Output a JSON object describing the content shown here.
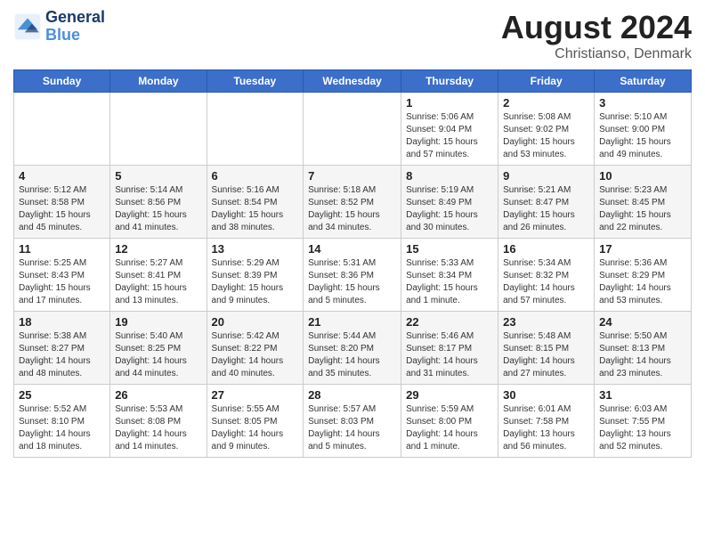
{
  "logo": {
    "line1": "General",
    "line2": "Blue"
  },
  "title": {
    "month_year": "August 2024",
    "location": "Christianso, Denmark"
  },
  "days_of_week": [
    "Sunday",
    "Monday",
    "Tuesday",
    "Wednesday",
    "Thursday",
    "Friday",
    "Saturday"
  ],
  "weeks": [
    [
      {
        "day": "",
        "info": ""
      },
      {
        "day": "",
        "info": ""
      },
      {
        "day": "",
        "info": ""
      },
      {
        "day": "",
        "info": ""
      },
      {
        "day": "1",
        "info": "Sunrise: 5:06 AM\nSunset: 9:04 PM\nDaylight: 15 hours and 57 minutes."
      },
      {
        "day": "2",
        "info": "Sunrise: 5:08 AM\nSunset: 9:02 PM\nDaylight: 15 hours and 53 minutes."
      },
      {
        "day": "3",
        "info": "Sunrise: 5:10 AM\nSunset: 9:00 PM\nDaylight: 15 hours and 49 minutes."
      }
    ],
    [
      {
        "day": "4",
        "info": "Sunrise: 5:12 AM\nSunset: 8:58 PM\nDaylight: 15 hours and 45 minutes."
      },
      {
        "day": "5",
        "info": "Sunrise: 5:14 AM\nSunset: 8:56 PM\nDaylight: 15 hours and 41 minutes."
      },
      {
        "day": "6",
        "info": "Sunrise: 5:16 AM\nSunset: 8:54 PM\nDaylight: 15 hours and 38 minutes."
      },
      {
        "day": "7",
        "info": "Sunrise: 5:18 AM\nSunset: 8:52 PM\nDaylight: 15 hours and 34 minutes."
      },
      {
        "day": "8",
        "info": "Sunrise: 5:19 AM\nSunset: 8:49 PM\nDaylight: 15 hours and 30 minutes."
      },
      {
        "day": "9",
        "info": "Sunrise: 5:21 AM\nSunset: 8:47 PM\nDaylight: 15 hours and 26 minutes."
      },
      {
        "day": "10",
        "info": "Sunrise: 5:23 AM\nSunset: 8:45 PM\nDaylight: 15 hours and 22 minutes."
      }
    ],
    [
      {
        "day": "11",
        "info": "Sunrise: 5:25 AM\nSunset: 8:43 PM\nDaylight: 15 hours and 17 minutes."
      },
      {
        "day": "12",
        "info": "Sunrise: 5:27 AM\nSunset: 8:41 PM\nDaylight: 15 hours and 13 minutes."
      },
      {
        "day": "13",
        "info": "Sunrise: 5:29 AM\nSunset: 8:39 PM\nDaylight: 15 hours and 9 minutes."
      },
      {
        "day": "14",
        "info": "Sunrise: 5:31 AM\nSunset: 8:36 PM\nDaylight: 15 hours and 5 minutes."
      },
      {
        "day": "15",
        "info": "Sunrise: 5:33 AM\nSunset: 8:34 PM\nDaylight: 15 hours and 1 minute."
      },
      {
        "day": "16",
        "info": "Sunrise: 5:34 AM\nSunset: 8:32 PM\nDaylight: 14 hours and 57 minutes."
      },
      {
        "day": "17",
        "info": "Sunrise: 5:36 AM\nSunset: 8:29 PM\nDaylight: 14 hours and 53 minutes."
      }
    ],
    [
      {
        "day": "18",
        "info": "Sunrise: 5:38 AM\nSunset: 8:27 PM\nDaylight: 14 hours and 48 minutes."
      },
      {
        "day": "19",
        "info": "Sunrise: 5:40 AM\nSunset: 8:25 PM\nDaylight: 14 hours and 44 minutes."
      },
      {
        "day": "20",
        "info": "Sunrise: 5:42 AM\nSunset: 8:22 PM\nDaylight: 14 hours and 40 minutes."
      },
      {
        "day": "21",
        "info": "Sunrise: 5:44 AM\nSunset: 8:20 PM\nDaylight: 14 hours and 35 minutes."
      },
      {
        "day": "22",
        "info": "Sunrise: 5:46 AM\nSunset: 8:17 PM\nDaylight: 14 hours and 31 minutes."
      },
      {
        "day": "23",
        "info": "Sunrise: 5:48 AM\nSunset: 8:15 PM\nDaylight: 14 hours and 27 minutes."
      },
      {
        "day": "24",
        "info": "Sunrise: 5:50 AM\nSunset: 8:13 PM\nDaylight: 14 hours and 23 minutes."
      }
    ],
    [
      {
        "day": "25",
        "info": "Sunrise: 5:52 AM\nSunset: 8:10 PM\nDaylight: 14 hours and 18 minutes."
      },
      {
        "day": "26",
        "info": "Sunrise: 5:53 AM\nSunset: 8:08 PM\nDaylight: 14 hours and 14 minutes."
      },
      {
        "day": "27",
        "info": "Sunrise: 5:55 AM\nSunset: 8:05 PM\nDaylight: 14 hours and 9 minutes."
      },
      {
        "day": "28",
        "info": "Sunrise: 5:57 AM\nSunset: 8:03 PM\nDaylight: 14 hours and 5 minutes."
      },
      {
        "day": "29",
        "info": "Sunrise: 5:59 AM\nSunset: 8:00 PM\nDaylight: 14 hours and 1 minute."
      },
      {
        "day": "30",
        "info": "Sunrise: 6:01 AM\nSunset: 7:58 PM\nDaylight: 13 hours and 56 minutes."
      },
      {
        "day": "31",
        "info": "Sunrise: 6:03 AM\nSunset: 7:55 PM\nDaylight: 13 hours and 52 minutes."
      }
    ]
  ]
}
